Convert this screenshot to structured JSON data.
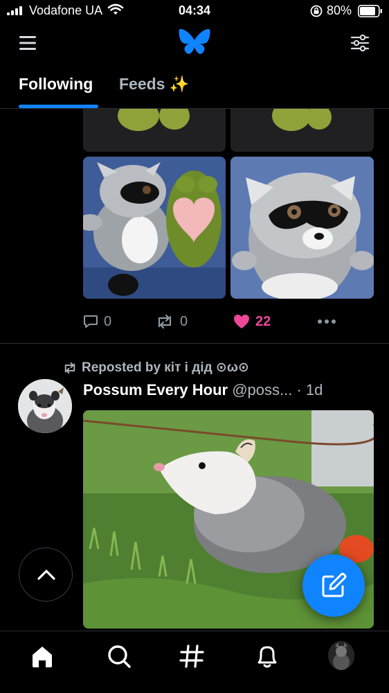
{
  "status_bar": {
    "carrier": "Vodafone UA",
    "time": "04:34",
    "battery": "80%"
  },
  "header": {
    "icons": [
      "menu-icon",
      "bluesky-butterfly-logo",
      "feed-settings-icon"
    ]
  },
  "tabs": [
    {
      "label": "Following",
      "active": true
    },
    {
      "label": "Feeds ✨",
      "active": false
    }
  ],
  "previous_post": {
    "actions": {
      "replies": "0",
      "reposts": "0",
      "likes": "22",
      "liked": true
    }
  },
  "post": {
    "repost_label": "Reposted by кіт і дід ⊙ω⊙",
    "author_name": "Possum Every Hour",
    "author_handle": "@poss...",
    "time": "· 1d"
  },
  "bottom_nav": {
    "items": [
      "home-icon",
      "search-icon",
      "hashtag-icon",
      "bell-icon",
      "profile-avatar"
    ],
    "active": "home-icon"
  },
  "colors": {
    "accent": "#1083fe",
    "like": "#ec4899",
    "muted_text": "#aeb6bf",
    "background": "#000000"
  }
}
